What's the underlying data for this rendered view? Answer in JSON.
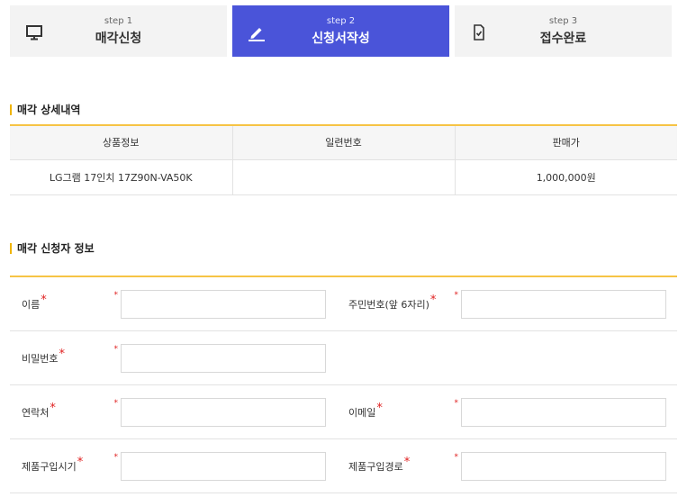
{
  "steps": [
    {
      "num": "step 1",
      "name": "매각신청",
      "icon": "monitor-icon"
    },
    {
      "num": "step 2",
      "name": "신청서작성",
      "icon": "pencil-icon"
    },
    {
      "num": "step 3",
      "name": "접수완료",
      "icon": "document-check-icon"
    }
  ],
  "colors": {
    "active_step": "#4a54d9",
    "accent_line": "#f6c445",
    "required": "#e02020"
  },
  "detail": {
    "title": "매각 상세내역",
    "headers": [
      "상품정보",
      "일련번호",
      "판매가"
    ],
    "row": {
      "product": "LG그램 17인치 17Z90N-VA50K",
      "serial": "",
      "price": "1,000,000원"
    }
  },
  "applicant": {
    "title": "매각 신청자 정보",
    "required_mark": "*",
    "fields": {
      "name": "이름",
      "rrn": "주민번호(앞 6자리)",
      "password": "비밀번호",
      "contact": "연락처",
      "email": "이메일",
      "purchase_date": "제품구입시기",
      "purchase_route": "제품구입경로"
    }
  }
}
